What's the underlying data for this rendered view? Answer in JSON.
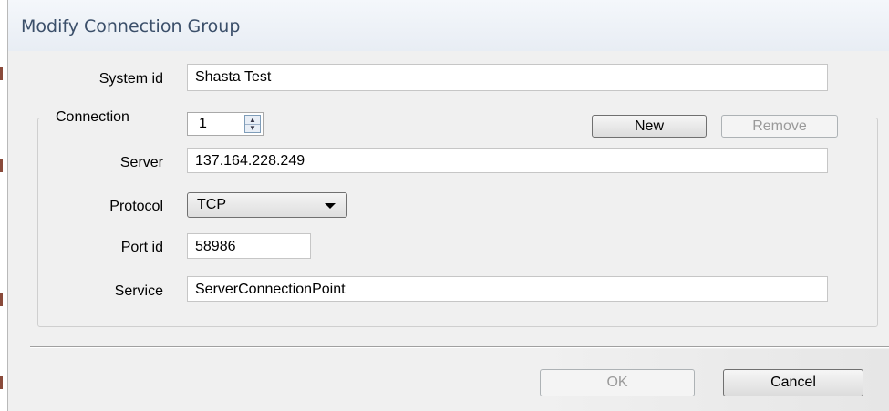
{
  "window": {
    "title": "Modify Connection Group"
  },
  "system_id": {
    "label": "System id",
    "value": "Shasta Test"
  },
  "connection": {
    "group_label": "Connection",
    "index": "1",
    "new_label": "New",
    "remove_label": "Remove",
    "server": {
      "label": "Server",
      "value": "137.164.228.249"
    },
    "protocol": {
      "label": "Protocol",
      "value": "TCP"
    },
    "port": {
      "label": "Port id",
      "value": "58986"
    },
    "service": {
      "label": "Service",
      "value": "ServerConnectionPoint"
    }
  },
  "buttons": {
    "ok_label": "OK",
    "cancel_label": "Cancel"
  }
}
